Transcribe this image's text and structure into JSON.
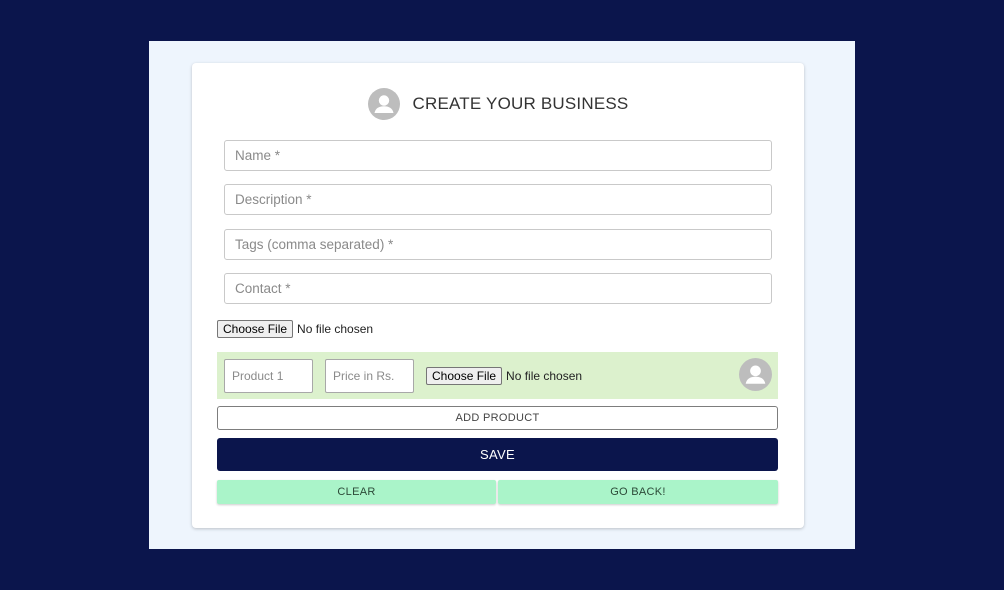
{
  "form": {
    "title": "CREATE YOUR BUSINESS",
    "fields": {
      "name_placeholder": "Name *",
      "description_placeholder": "Description *",
      "tags_placeholder": "Tags (comma separated) *",
      "contact_placeholder": "Contact *"
    },
    "file": {
      "button_label": "Choose File",
      "status": "No file chosen"
    },
    "product": {
      "name_placeholder": "Product 1",
      "price_placeholder": "Price in Rs.",
      "file_button_label": "Choose File",
      "file_status": "No file chosen",
      "image_icon": "person-avatar-icon"
    },
    "buttons": {
      "add_product": "ADD PRODUCT",
      "save": "SAVE",
      "clear": "CLEAR",
      "go_back": "GO BACK!"
    },
    "header_icon": "person-avatar-icon"
  },
  "colors": {
    "background": "#0b154c",
    "frame": "#eef5fd",
    "product_row": "#dcf1cd",
    "save_button": "#0b154c",
    "secondary_buttons": "#aaf4c9"
  }
}
